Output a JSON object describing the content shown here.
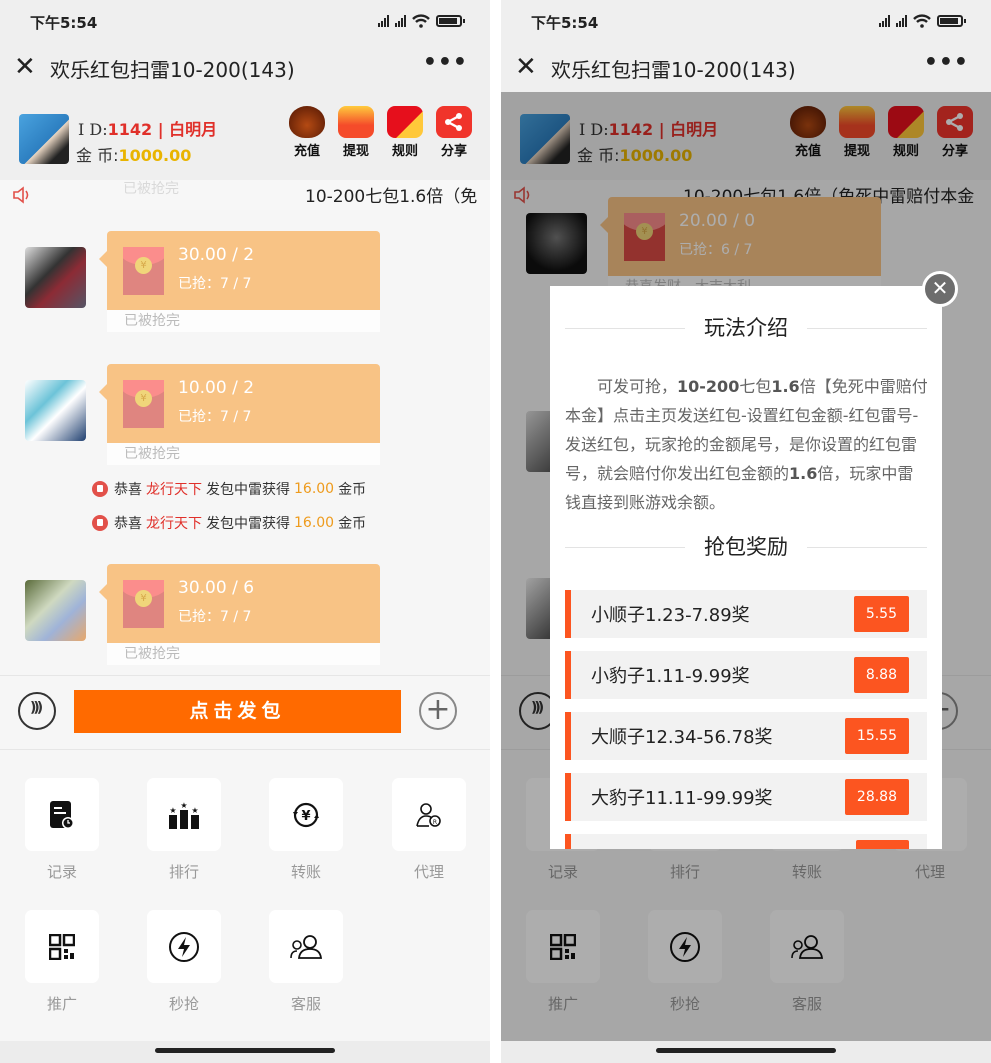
{
  "status_bar": {
    "time": "下午5:54"
  },
  "nav": {
    "title": "欢乐红包扫雷10-200(143)",
    "close": "✕",
    "more": "•••"
  },
  "user": {
    "id_label": "I D:",
    "id_value": "1142 | 白明月",
    "coins_label": "金 币:",
    "coins_value": "1000.00"
  },
  "actions": [
    {
      "label": "充值",
      "icon": "money-bag-icon"
    },
    {
      "label": "提现",
      "icon": "withdraw-envelope-icon"
    },
    {
      "label": "规则",
      "icon": "rules-redpacket-icon"
    },
    {
      "label": "分享",
      "icon": "share-icon"
    }
  ],
  "notice": {
    "left_text": "10-200七包1.6倍（免",
    "right_text": "10-200七包1.6倍（免死中雷赔付本金",
    "faded_status": "已被抢完"
  },
  "messages_left": [
    {
      "amount": "30.00 / 2",
      "grabbed": "已抢：7 / 7",
      "status": "已被抢完"
    },
    {
      "amount": "10.00 / 2",
      "grabbed": "已抢：7 / 7",
      "status": "已被抢完"
    },
    {
      "amount": "30.00 / 6",
      "grabbed": "已抢：7 / 7",
      "status": "已被抢完"
    }
  ],
  "system_lines": [
    {
      "prefix": "恭喜",
      "name": "龙行天下",
      "middle": "发包中雷获得",
      "amount": "16.00",
      "suffix": "金币"
    },
    {
      "prefix": "恭喜",
      "name": "龙行天下",
      "middle": "发包中雷获得",
      "amount": "16.00",
      "suffix": "金币"
    }
  ],
  "messages_right": [
    {
      "amount": "20.00 / 0",
      "grabbed": "已抢：6 / 7",
      "status": "恭喜发财，大吉大利"
    }
  ],
  "composer": {
    "send_label": "点击发包",
    "plus": "+"
  },
  "grid": [
    {
      "label": "记录",
      "icon": "record-icon"
    },
    {
      "label": "排行",
      "icon": "ranking-icon"
    },
    {
      "label": "转账",
      "icon": "transfer-icon"
    },
    {
      "label": "代理",
      "icon": "agent-icon"
    },
    {
      "label": "推广",
      "icon": "qrcode-icon"
    },
    {
      "label": "秒抢",
      "icon": "lightning-icon"
    },
    {
      "label": "客服",
      "icon": "customer-service-icon"
    }
  ],
  "modal": {
    "close": "✕",
    "intro_title": "玩法介绍",
    "intro_parts": {
      "p1": "可发可抢，",
      "b1": "10-200",
      "p2": "七包",
      "b2": "1.6",
      "p3": "倍【免死中雷赔付本金】点击主页发送红包-设置红包金额-红包雷号-发送红包，玩家抢的金额尾号，是你设置的红包雷号，就会赔付你发出红包金额的",
      "b3": "1.6",
      "p4": "倍，玩家中雷钱直接到账游戏余额。"
    },
    "reward_title": "抢包奖励",
    "rewards": [
      {
        "label": "小顺子1.23-7.89奖",
        "value": "5.55"
      },
      {
        "label": "小豹子1.11-9.99奖",
        "value": "8.88"
      },
      {
        "label": "大顺子12.34-56.78奖",
        "value": "15.55"
      },
      {
        "label": "大豹子11.11-99.99奖",
        "value": "28.88"
      },
      {
        "label": "",
        "value": ""
      }
    ]
  },
  "colors": {
    "accent_orange": "#ff6a00",
    "reward_orange": "#fc5520",
    "bubble": "#f8c385",
    "id_red": "#e0302a",
    "coin_yellow": "#e9b400"
  }
}
